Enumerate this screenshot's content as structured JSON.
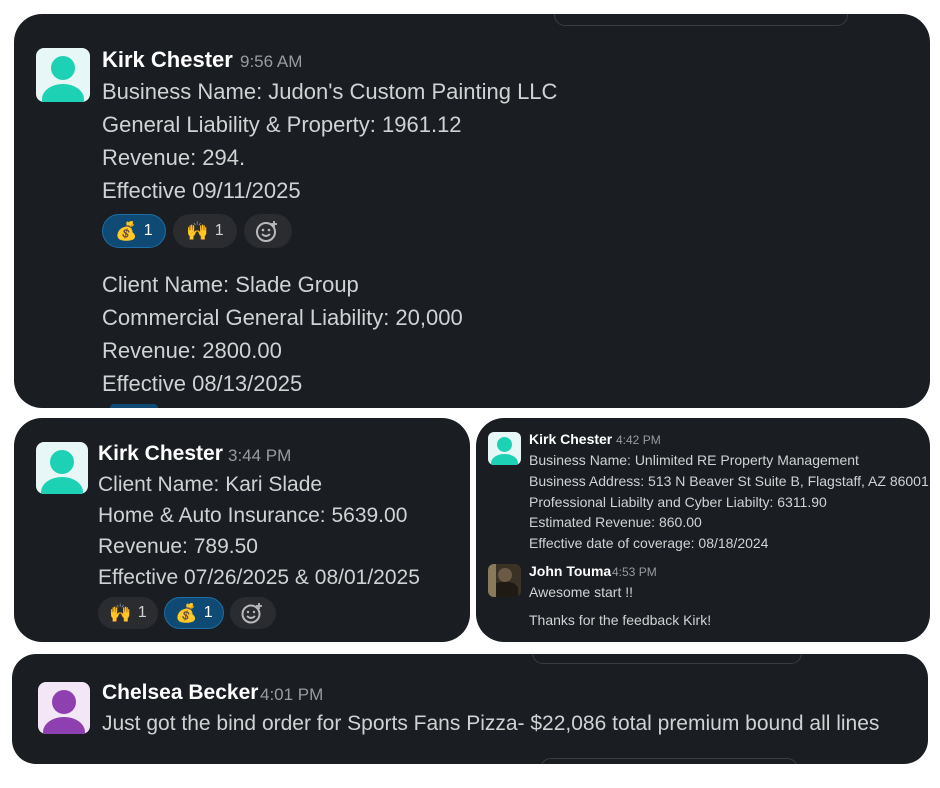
{
  "card1": {
    "author": "Kirk Chester",
    "time": "9:56 AM",
    "lines": [
      "Business Name: Judon's Custom Painting LLC",
      "General Liability & Property: 1961.12",
      "Revenue: 294.",
      "Effective 09/11/2025"
    ],
    "reactions": [
      {
        "emoji": "💰",
        "count": "1",
        "active": true
      },
      {
        "emoji": "🙌",
        "count": "1",
        "active": false
      }
    ],
    "lines2": [
      "Client Name: Slade Group",
      "Commercial General Liability: 20,000",
      "Revenue: 2800.00",
      "Effective 08/13/2025"
    ]
  },
  "card2": {
    "author": "Kirk Chester",
    "time": "3:44 PM",
    "lines": [
      "Client Name: Kari Slade",
      "Home & Auto Insurance: 5639.00",
      "Revenue: 789.50",
      "Effective 07/26/2025 & 08/01/2025"
    ],
    "reactions": [
      {
        "emoji": "🙌",
        "count": "1",
        "active": false
      },
      {
        "emoji": "💰",
        "count": "1",
        "active": true
      }
    ]
  },
  "card3": {
    "author": "Kirk Chester",
    "time": "4:42 PM",
    "lines": [
      "Business Name: Unlimited RE Property Management",
      "Business Address: 513 N Beaver St Suite B, Flagstaff, AZ 86001",
      "Professional Liabilty and Cyber Liabilty: 6311.90",
      "Estimated Revenue: 860.00",
      "Effective date of coverage: 08/18/2024"
    ],
    "reply_author": "John Touma",
    "reply_time": "4:53 PM",
    "reply_lines": [
      "Awesome start !!",
      "Thanks for the feedback Kirk!"
    ]
  },
  "card4": {
    "author": "Chelsea Becker",
    "time": "4:01 PM",
    "text": "Just got the bind order for Sports Fans Pizza- $22,086 total premium bound all lines"
  },
  "colors": {
    "card_bg": "#1a1d21",
    "active_reaction": "#0e4a73",
    "teal_avatar": "#1dd1b4",
    "purple_avatar": "#8e3fb0"
  }
}
